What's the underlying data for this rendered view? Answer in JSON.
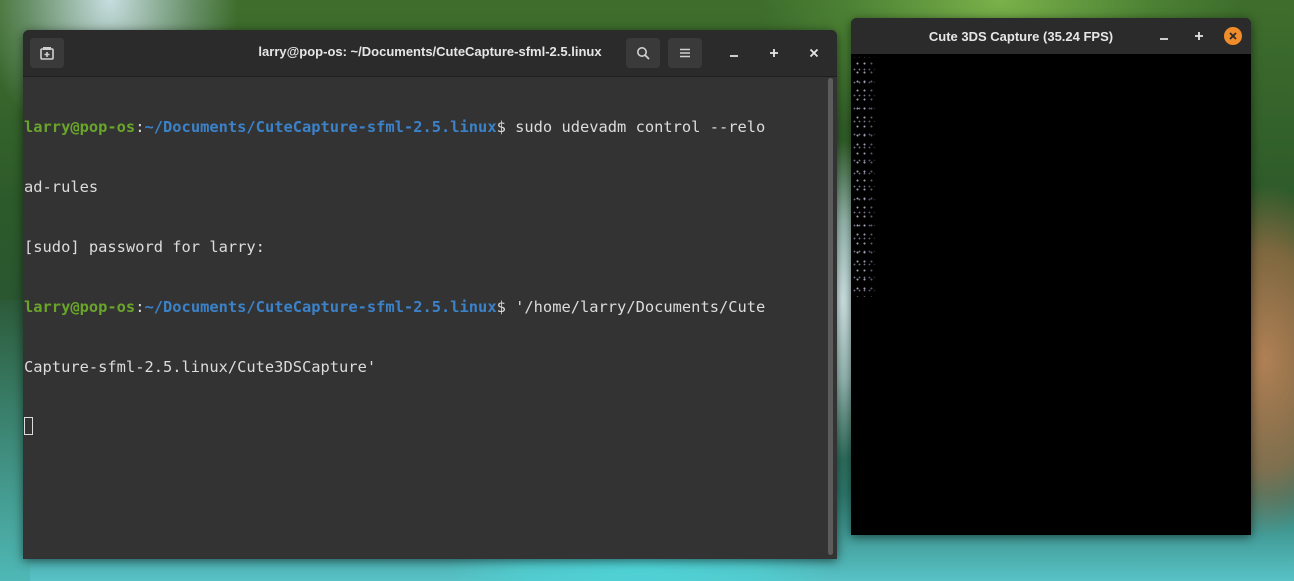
{
  "terminal": {
    "title": "larry@pop-os: ~/Documents/CuteCapture-sfml-2.5.linux",
    "lines": [
      {
        "user": "larry@pop-os",
        "sep": ":",
        "path": "~/Documents/CuteCapture-sfml-2.5.linux",
        "cmd": "$ sudo udevadm control --relo"
      },
      {
        "text": "ad-rules"
      },
      {
        "text": "[sudo] password for larry:"
      },
      {
        "user": "larry@pop-os",
        "sep": ":",
        "path": "~/Documents/CuteCapture-sfml-2.5.linux",
        "cmd": "$ '/home/larry/Documents/Cute"
      },
      {
        "text": "Capture-sfml-2.5.linux/Cute3DSCapture'"
      }
    ],
    "icons": {
      "new_tab": "new-tab-icon",
      "search": "search-icon",
      "menu": "hamburger-menu-icon",
      "minimize": "minimize-icon",
      "maximize": "maximize-icon",
      "close": "close-icon"
    }
  },
  "capture_window": {
    "title": "Cute 3DS Capture (35.24 FPS)",
    "icons": {
      "minimize": "minimize-icon",
      "maximize": "maximize-icon",
      "close": "close-icon"
    },
    "close_color": "#f08c2a"
  },
  "colors": {
    "prompt_user": "#6aa52b",
    "prompt_path": "#3b82c9",
    "terminal_bg": "#333333",
    "header_bg": "#2b2b2b"
  }
}
